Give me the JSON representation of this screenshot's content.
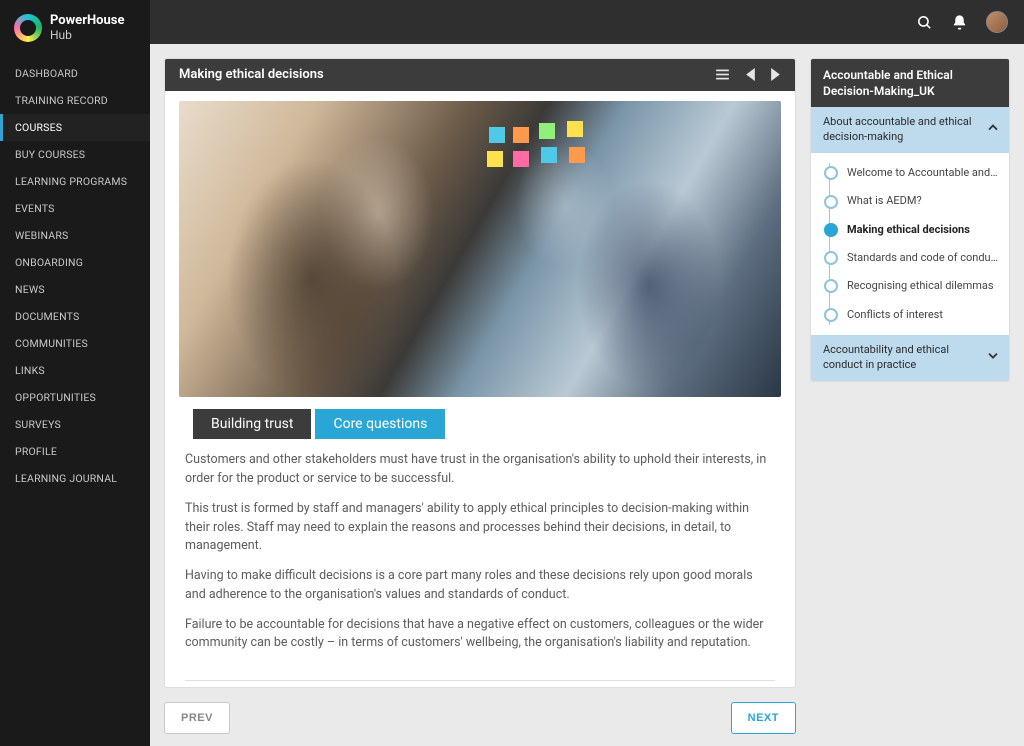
{
  "brand": {
    "line1": "PowerHouse",
    "line2": "Hub"
  },
  "nav": {
    "items": [
      "DASHBOARD",
      "TRAINING RECORD",
      "COURSES",
      "BUY COURSES",
      "LEARNING PROGRAMS",
      "EVENTS",
      "WEBINARS",
      "ONBOARDING",
      "NEWS",
      "DOCUMENTS",
      "COMMUNITIES",
      "LINKS",
      "OPPORTUNITIES",
      "SURVEYS",
      "PROFILE",
      "LEARNING JOURNAL"
    ],
    "activeIndex": 2
  },
  "lesson": {
    "title": "Making ethical decisions",
    "tabs": {
      "active": "Building trust",
      "other": "Core questions"
    },
    "paragraphs": [
      "Customers and other stakeholders must have trust in the organisation's ability to uphold their interests, in order for the product or service to be successful.",
      "This trust is formed by staff and managers' ability to apply ethical principles to decision-making within their roles. Staff may need to explain the reasons and processes behind their decisions, in detail, to management.",
      "Having to make difficult decisions is a core part many roles and these decisions rely upon good morals and adherence to the organisation's values and standards of conduct.",
      "Failure to be accountable for decisions that have a negative effect on customers, colleagues or the wider community can be costly – in terms of customers' wellbeing, the organisation's liability and reputation."
    ],
    "pager": {
      "prev": "PREV",
      "next": "NEXT"
    }
  },
  "outline": {
    "courseTitle": "Accountable and Ethical Decision-Making_UK",
    "section1": {
      "label": "About accountable and ethical decision-making",
      "expanded": true
    },
    "items": [
      "Welcome to Accountable and Ethical D…",
      "What is AEDM?",
      "Making ethical decisions",
      "Standards and code of conduct",
      "Recognising ethical dilemmas",
      "Conflicts of interest"
    ],
    "activeItemIndex": 2,
    "section2": {
      "label": "Accountability and ethical conduct in practice",
      "expanded": false
    }
  }
}
